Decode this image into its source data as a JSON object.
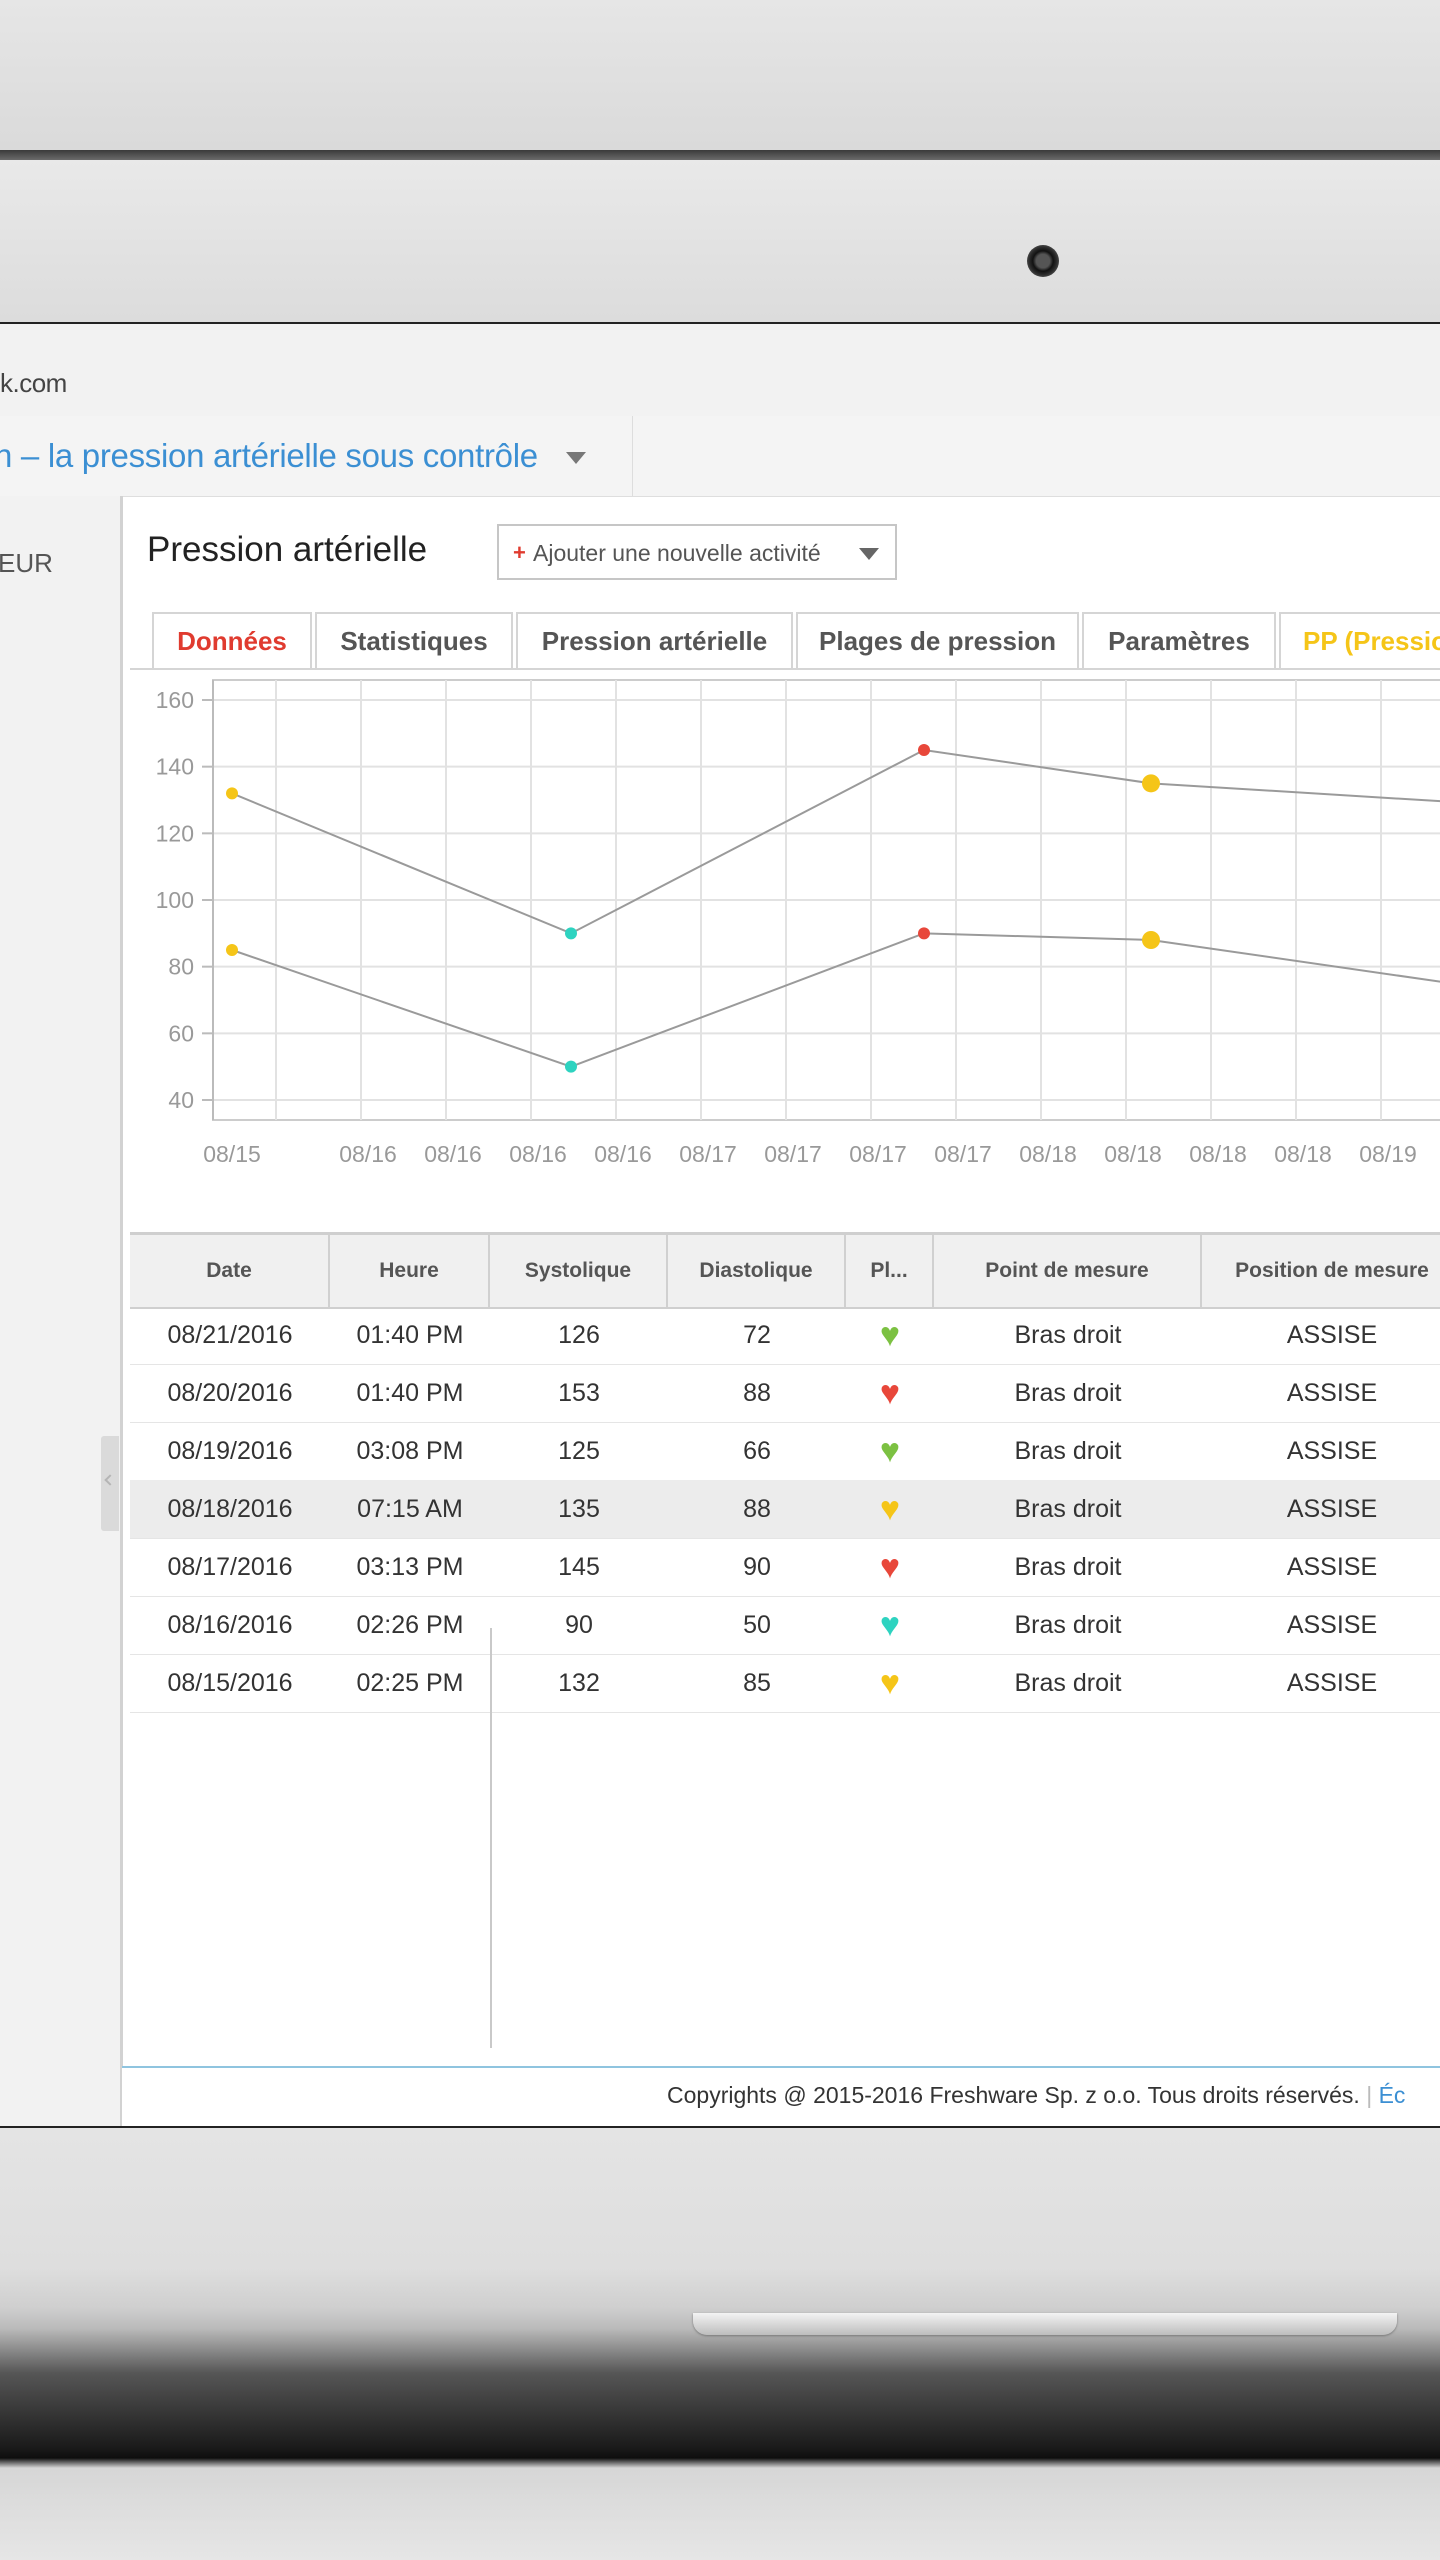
{
  "browser": {
    "url": "k.com"
  },
  "app": {
    "title": "n – la pression artérielle sous contrôle"
  },
  "sidebar": {
    "items": [
      {
        "label": "EUR"
      }
    ]
  },
  "page": {
    "title": "Pression artérielle",
    "add_button_icon": "+",
    "add_button_label": "Ajouter une nouvelle activité"
  },
  "tabs": [
    {
      "label": "Données",
      "active": true,
      "color": "#e03b2f"
    },
    {
      "label": "Statistiques",
      "color": "#555555"
    },
    {
      "label": "Pression artérielle",
      "color": "#555555"
    },
    {
      "label": "Plages de pression",
      "color": "#555555"
    },
    {
      "label": "Paramètres",
      "color": "#555555"
    },
    {
      "label": "PP (Pressio",
      "color": "#f5c518"
    }
  ],
  "chart_data": {
    "type": "line",
    "title": "",
    "xlabel": "",
    "ylabel": "",
    "ylim": [
      40,
      160
    ],
    "y_ticks": [
      160,
      140,
      120,
      100,
      80,
      60,
      40
    ],
    "x_tick_labels": [
      "08/15",
      "08/16",
      "08/16",
      "08/16",
      "08/16",
      "08/17",
      "08/17",
      "08/17",
      "08/17",
      "08/18",
      "08/18",
      "08/18",
      "08/18",
      "08/19"
    ],
    "grid": true,
    "categories": [
      "08/15",
      "08/16",
      "08/17",
      "08/18",
      "08/19"
    ],
    "series": [
      {
        "values": [
          132,
          90,
          145,
          135,
          129
        ],
        "point_colors": [
          "#f5c518",
          "#2ed3c0",
          "#e8473a",
          "#f5c518",
          null
        ]
      },
      {
        "values": [
          85,
          50,
          90,
          88,
          74
        ],
        "point_colors": [
          "#f5c518",
          "#2ed3c0",
          "#e8473a",
          "#f5c518",
          null
        ]
      }
    ]
  },
  "table": {
    "headers": [
      "Date",
      "Heure",
      "Systolique",
      "Diastolique",
      "Pl...",
      "Point de mesure",
      "Position de mesure"
    ],
    "rows": [
      {
        "date": "08/21/2016",
        "time": "01:40 PM",
        "sys": "126",
        "dia": "72",
        "heart": "green-heart-icon",
        "heart_color": "#7cc142",
        "point": "Bras droit",
        "position": "ASSISE"
      },
      {
        "date": "08/20/2016",
        "time": "01:40 PM",
        "sys": "153",
        "dia": "88",
        "heart": "red-heart-icon",
        "heart_color": "#e8473a",
        "point": "Bras droit",
        "position": "ASSISE"
      },
      {
        "date": "08/19/2016",
        "time": "03:08 PM",
        "sys": "125",
        "dia": "66",
        "heart": "green-heart-icon",
        "heart_color": "#7cc142",
        "point": "Bras droit",
        "position": "ASSISE"
      },
      {
        "date": "08/18/2016",
        "time": "07:15 AM",
        "sys": "135",
        "dia": "88",
        "heart": "yellow-heart-icon",
        "heart_color": "#f5c518",
        "point": "Bras droit",
        "position": "ASSISE",
        "highlighted": true
      },
      {
        "date": "08/17/2016",
        "time": "03:13 PM",
        "sys": "145",
        "dia": "90",
        "heart": "red-heart-icon",
        "heart_color": "#e8473a",
        "point": "Bras droit",
        "position": "ASSISE"
      },
      {
        "date": "08/16/2016",
        "time": "02:26 PM",
        "sys": "90",
        "dia": "50",
        "heart": "teal-heart-icon",
        "heart_color": "#2ed3c0",
        "point": "Bras droit",
        "position": "ASSISE"
      },
      {
        "date": "08/15/2016",
        "time": "02:25 PM",
        "sys": "132",
        "dia": "85",
        "heart": "yellow-heart-icon",
        "heart_color": "#f5c518",
        "point": "Bras droit",
        "position": "ASSISE"
      }
    ]
  },
  "footer": {
    "copyright": "Copyrights @ 2015-2016 Freshware Sp. z o.o. Tous droits réservés.",
    "separator": "|",
    "link": "Éc"
  }
}
